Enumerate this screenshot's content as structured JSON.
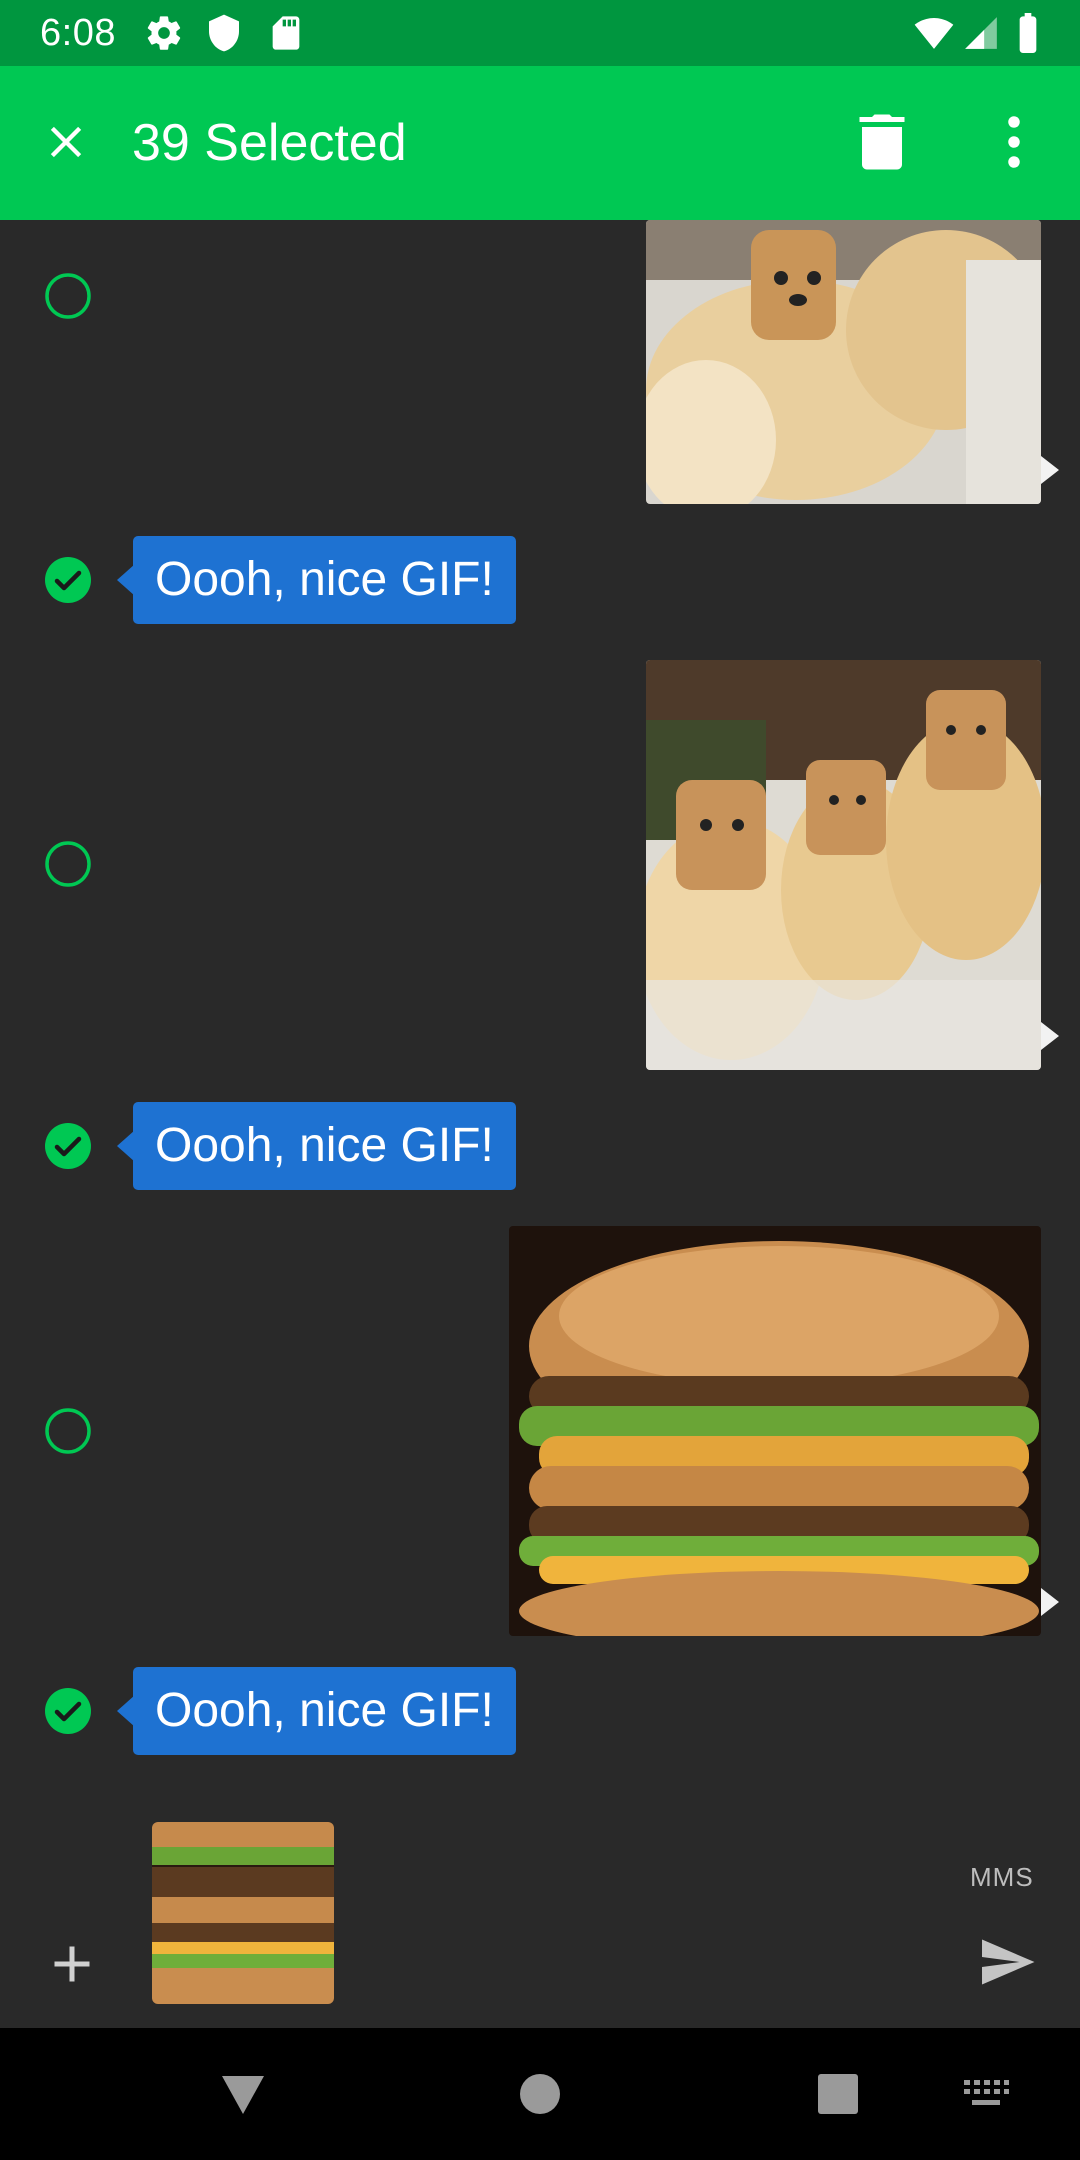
{
  "status_bar": {
    "time": "6:08",
    "icons_left": [
      "settings-icon",
      "shield-icon",
      "sd-card-icon"
    ],
    "icons_right": [
      "wifi-icon",
      "signal-icon",
      "battery-icon"
    ]
  },
  "toolbar": {
    "title": "39 Selected",
    "close_icon": "close-icon",
    "delete_icon": "trash-icon",
    "more_icon": "more-vert-icon"
  },
  "messages": [
    {
      "type": "media",
      "direction": "outgoing",
      "content": "Pomeranian dogs with bread on their heads GIF",
      "selected": false
    },
    {
      "type": "text",
      "direction": "incoming",
      "text": "Oooh, nice GIF!",
      "selected": true
    },
    {
      "type": "media",
      "direction": "outgoing",
      "content": "Pomeranian dogs with bread on their heads GIF",
      "selected": false
    },
    {
      "type": "text",
      "direction": "incoming",
      "text": "Oooh, nice GIF!",
      "selected": true
    },
    {
      "type": "media",
      "direction": "outgoing",
      "content": "Stacked burger GIF",
      "selected": false
    },
    {
      "type": "text",
      "direction": "incoming",
      "text": "Oooh, nice GIF!",
      "selected": true
    }
  ],
  "composer": {
    "attachment": "burger thumbnail",
    "mode_label": "MMS",
    "add_icon": "plus-icon",
    "send_icon": "send-icon"
  },
  "nav_bar": {
    "icons": [
      "back-icon",
      "home-icon",
      "recents-icon",
      "keyboard-icon"
    ]
  },
  "colors": {
    "status_bar": "#00963f",
    "toolbar": "#00c853",
    "background": "#292929",
    "bubble": "#1e72d2",
    "accent": "#00c853"
  }
}
